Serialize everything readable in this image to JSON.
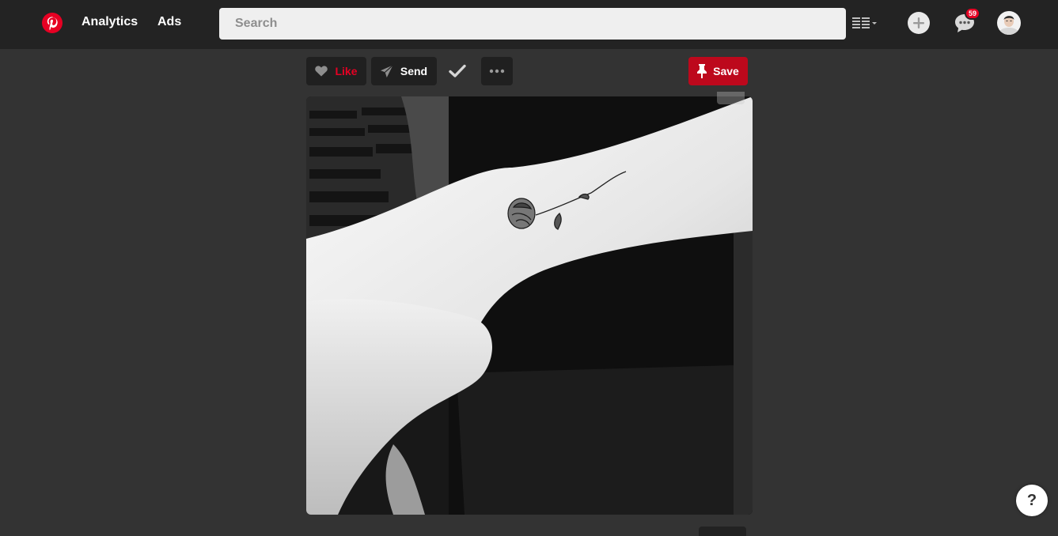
{
  "header": {
    "logo_icon": "pinterest-logo-icon",
    "nav": [
      {
        "label": "Analytics"
      },
      {
        "label": "Ads"
      }
    ],
    "search": {
      "placeholder": "Search",
      "value": ""
    },
    "view_toggle_icon": "list-view-icon",
    "add_icon": "plus-circle-icon",
    "messages": {
      "icon": "speech-bubble-icon",
      "badge_count": "59"
    },
    "avatar_icon": "user-avatar"
  },
  "pin_actions": {
    "like_label": "Like",
    "send_label": "Send",
    "check_icon": "checkmark-icon",
    "more_icon": "more-dots-icon",
    "save_label": "Save"
  },
  "pin": {
    "image_icon": "wrist-rose-tattoo-photo",
    "expand_icon": "expand-icon"
  },
  "help": {
    "label": "?"
  },
  "colors": {
    "background": "#333333",
    "topbar": "#232323",
    "brand_red": "#e60023",
    "save_red": "#bd081c",
    "button_dark": "#202020"
  }
}
